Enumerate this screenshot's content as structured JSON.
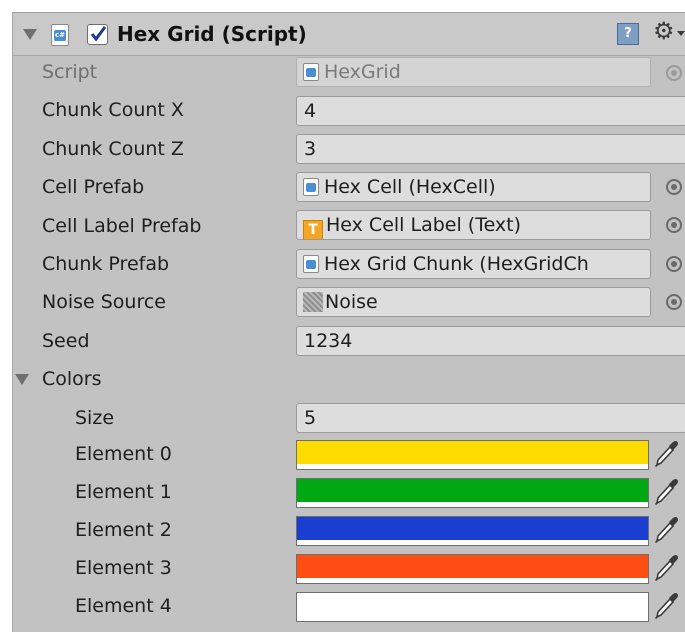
{
  "component": {
    "title": "Hex Grid (Script)",
    "enabled": true,
    "help_glyph": "?",
    "gear_glyph": "⚙"
  },
  "rows": {
    "script": {
      "label": "Script",
      "value": "HexGrid"
    },
    "chunk_count_x": {
      "label": "Chunk Count X",
      "value": "4"
    },
    "chunk_count_z": {
      "label": "Chunk Count Z",
      "value": "3"
    },
    "cell_prefab": {
      "label": "Cell Prefab",
      "value": "Hex Cell (HexCell)"
    },
    "cell_label_prefab": {
      "label": "Cell Label Prefab",
      "value": "Hex Cell Label (Text)"
    },
    "chunk_prefab": {
      "label": "Chunk Prefab",
      "value": "Hex Grid Chunk (HexGridCh"
    },
    "noise_source": {
      "label": "Noise Source",
      "value": "Noise"
    },
    "seed": {
      "label": "Seed",
      "value": "1234"
    }
  },
  "colors": {
    "label": "Colors",
    "size_label": "Size",
    "size_value": "5",
    "elements": [
      {
        "label": "Element 0",
        "color": "#ffdc00"
      },
      {
        "label": "Element 1",
        "color": "#00a814"
      },
      {
        "label": "Element 2",
        "color": "#1a3fd0"
      },
      {
        "label": "Element 3",
        "color": "#ff4d14"
      },
      {
        "label": "Element 4",
        "color": "#ffffff"
      }
    ]
  },
  "icons": {
    "foldout": "triangle-down-icon",
    "script": "csharp-script-icon",
    "checkbox": "checkmark-icon",
    "help": "help-book-icon",
    "gear": "gear-icon",
    "object_picker": "object-picker-icon",
    "text_component": "text-component-icon",
    "noise_texture": "noise-texture-icon",
    "eyedropper": "eyedropper-icon"
  },
  "theme": {
    "panel_bg": "#c2c2c2",
    "field_bg": "#dddddd",
    "checkbox_check": "#1b3c8c",
    "csharp_blue": "#4a8fd6",
    "text_icon_orange": "#f5a623"
  }
}
